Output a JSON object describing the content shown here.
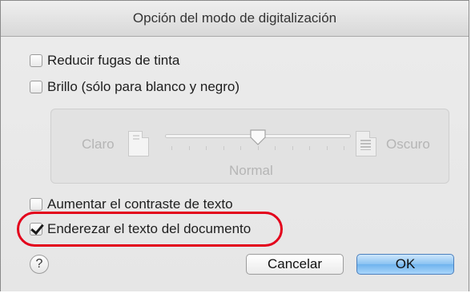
{
  "dialog": {
    "title": "Opción del modo de digitalización"
  },
  "options": {
    "reduce_ink": {
      "label": "Reducir fugas de tinta",
      "checked": false
    },
    "brightness": {
      "label": "Brillo (sólo para blanco y negro)",
      "checked": false
    },
    "contrast": {
      "label": "Aumentar el contraste de texto",
      "checked": false
    },
    "straighten": {
      "label": "Enderezar el texto del documento",
      "checked": true
    }
  },
  "brightness_slider": {
    "left_label": "Claro",
    "right_label": "Oscuro",
    "center_label": "Normal",
    "value_fraction": 0.5,
    "enabled": false
  },
  "buttons": {
    "cancel": "Cancelar",
    "ok": "OK",
    "help": "?"
  },
  "colors": {
    "highlight": "#e3001b",
    "default_button": "#89c2f2"
  },
  "icons": {
    "help": "help-icon",
    "light_doc": "light-document-icon",
    "dark_doc": "dark-document-icon"
  }
}
